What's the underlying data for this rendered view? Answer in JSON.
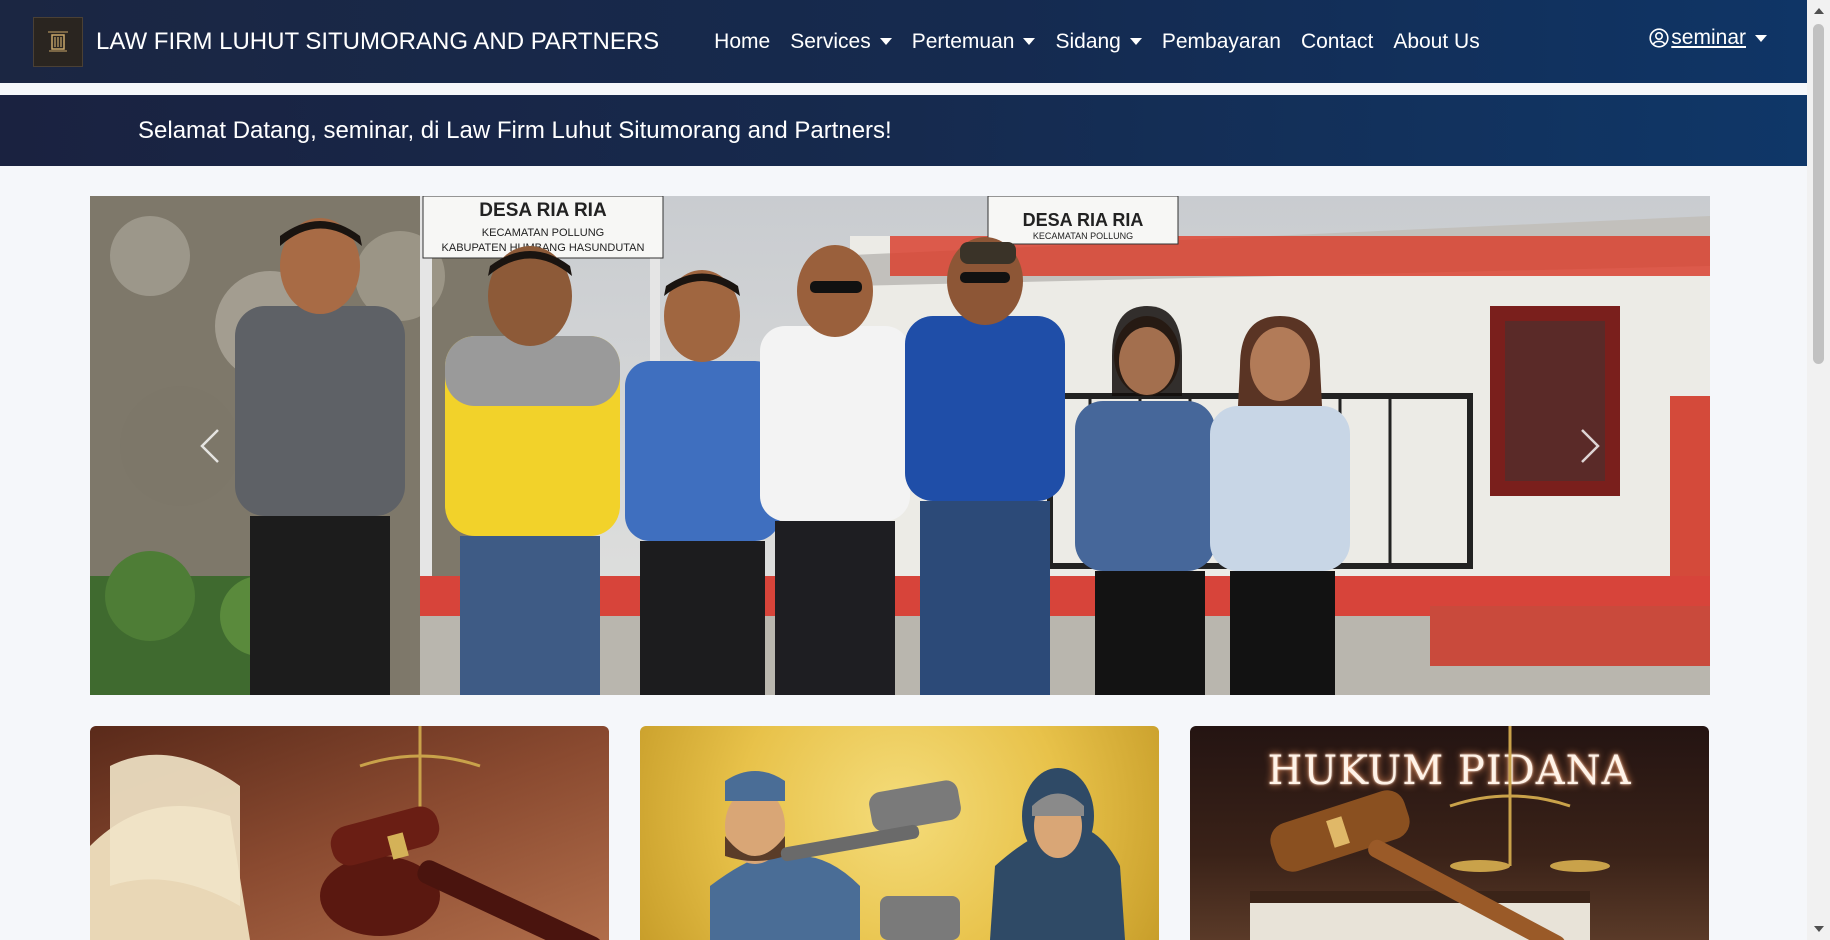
{
  "navbar": {
    "brand": "LAW FIRM LUHUT SITUMORANG AND PARTNERS",
    "links": [
      {
        "label": "Home",
        "dropdown": false
      },
      {
        "label": "Services",
        "dropdown": true
      },
      {
        "label": "Pertemuan",
        "dropdown": true
      },
      {
        "label": "Sidang",
        "dropdown": true
      },
      {
        "label": "Pembayaran",
        "dropdown": false
      },
      {
        "label": "Contact",
        "dropdown": false
      },
      {
        "label": "About Us",
        "dropdown": false
      }
    ],
    "user": "seminar",
    "user_icon": "user-circle-icon"
  },
  "welcome": {
    "text": "Selamat Datang, seminar, di Law Firm Luhut Situmorang and Partners!"
  },
  "carousel": {
    "sign_left_title": "DESA RIA RIA",
    "sign_left_line1": "KECAMATAN POLLUNG",
    "sign_left_line2": "KABUPATEN HUMBANG HASUNDUTAN",
    "sign_right_title": "DESA RIA RIA",
    "sign_right_line1": "KECAMATAN POLLUNG",
    "prev_icon": "chevron-left-icon",
    "next_icon": "chevron-right-icon"
  },
  "cards": [
    {
      "icon": "gavel-book-icon"
    },
    {
      "icon": "gavel-couple-icon"
    },
    {
      "title": "HUKUM PIDANA",
      "icon": "gavel-icon"
    }
  ],
  "colors": {
    "navbar_start": "#1b2642",
    "navbar_end": "#0f3566",
    "page_bg": "#f5f7fa"
  }
}
